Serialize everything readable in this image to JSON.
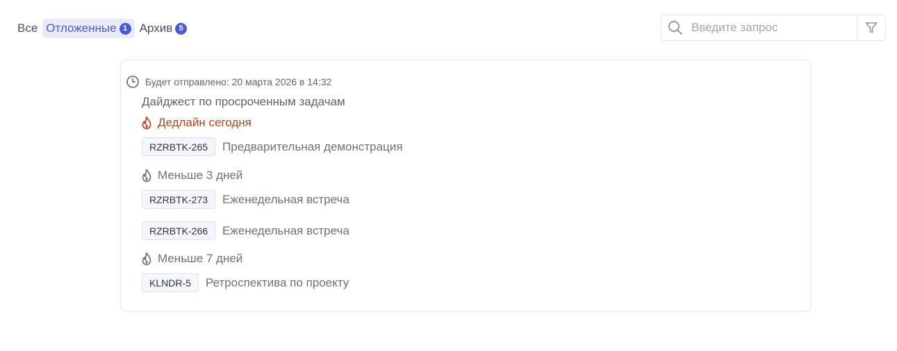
{
  "tabs": [
    {
      "label": "Все",
      "badge": null
    },
    {
      "label": "Отложенные",
      "badge": "1"
    },
    {
      "label": "Архив",
      "badge": "5"
    }
  ],
  "search": {
    "placeholder": "Введите запрос",
    "icon": "search-icon",
    "filter_icon": "filter-icon"
  },
  "card": {
    "scheduled_text": "Будет отправлено: 20 марта 2026 в 14:32",
    "subject": "Дайджест по просроченным задачам",
    "groups": [
      {
        "title": "Дедлайн сегодня",
        "color": "#c2421d",
        "tasks": [
          {
            "key": "RZRBTK-265",
            "title": "Предварительная демонстрация"
          }
        ]
      },
      {
        "title": "Меньше 3 дней",
        "color": "#6d717e",
        "tasks": [
          {
            "key": "RZRBTK-273",
            "title": "Еженедельная встреча"
          },
          {
            "key": "RZRBTK-266",
            "title": "Еженедельная встреча"
          }
        ]
      },
      {
        "title": "Меньше 7 дней",
        "color": "#6d717e",
        "tasks": [
          {
            "key": "KLNDR-5",
            "title": "Ретроспектива по проекту"
          }
        ]
      }
    ]
  },
  "colors": {
    "accent": "#4e5bd6",
    "accent_bg": "#e9ebfb",
    "urgent": "#c2421d"
  }
}
